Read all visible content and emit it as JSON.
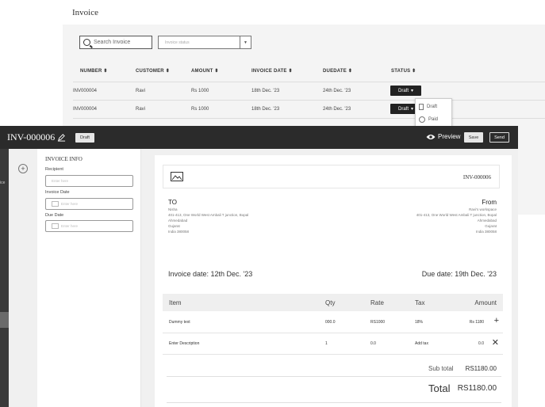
{
  "background_page": {
    "title": "Invoice",
    "search_placeholder": "Search Invoice",
    "status_placeholder": "Invoice status",
    "columns": [
      "NUMBER ⬍",
      "CUSTOMER ⬍",
      "AMOUNT ⬍",
      "INVOICE DATE ⬍",
      "DUEDATE ⬍",
      "STATUS ⬍"
    ],
    "rows": [
      {
        "number": "INV000004",
        "customer": "Ravi",
        "amount": "Rs 1000",
        "invoice_date": "18th Dec. '23",
        "due_date": "24th Dec. '23",
        "status": "Draft"
      },
      {
        "number": "INV000004",
        "customer": "Ravi",
        "amount": "Rs 1000",
        "invoice_date": "18th Dec. '23",
        "due_date": "24th Dec. '23",
        "status": "Draft"
      }
    ],
    "status_menu": [
      "Draft",
      "Paid"
    ]
  },
  "editor": {
    "invoice_number": "INV-000006",
    "status_badge": "Draft",
    "preview_label": "Preview",
    "save_label": "Save",
    "send_label": "Send",
    "side_label": "ice"
  },
  "info_panel": {
    "heading": "INVOICE INFO",
    "recipient_label": "Recipient",
    "recipient_placeholder": "Enter here",
    "invoice_date_label": "Invoice Date",
    "invoice_date_placeholder": "Enter here",
    "due_date_label": "Due Date",
    "due_date_placeholder": "Enter here"
  },
  "document": {
    "invoice_number": "INV-000006",
    "to_heading": "TO",
    "from_heading": "From",
    "to_address": [
      "Nisha",
      "401-413, One World West Ambali T junction, Bopal",
      "Ahmedabad",
      "Gujarat",
      "India 380058"
    ],
    "from_address": [
      "Ravi's workspace",
      "401-413, One World West Ambali T junction, Bopal",
      "Ahmedabad",
      "Gujarat",
      "India 380058"
    ],
    "invoice_date": "Invoice date: 12th Dec. '23",
    "due_date": "Due date: 19th Dec. '23",
    "items_header": {
      "item": "Item",
      "qty": "Qty",
      "rate": "Rate",
      "tax": "Tax",
      "amount": "Amount"
    },
    "items": [
      {
        "item": "Dummy text",
        "qty": "000.0",
        "rate": "RS1000",
        "tax": "18%",
        "amount": "Rs 1180",
        "action": "+"
      },
      {
        "item": "Enter Description",
        "qty": "1",
        "rate": "0.0",
        "tax": "Add tax",
        "amount": "0.0",
        "action": "✕"
      }
    ],
    "subtotal_label": "Sub total",
    "subtotal_value": "RS1180.00",
    "total_label": "Total",
    "total_value": "RS1180.00"
  }
}
